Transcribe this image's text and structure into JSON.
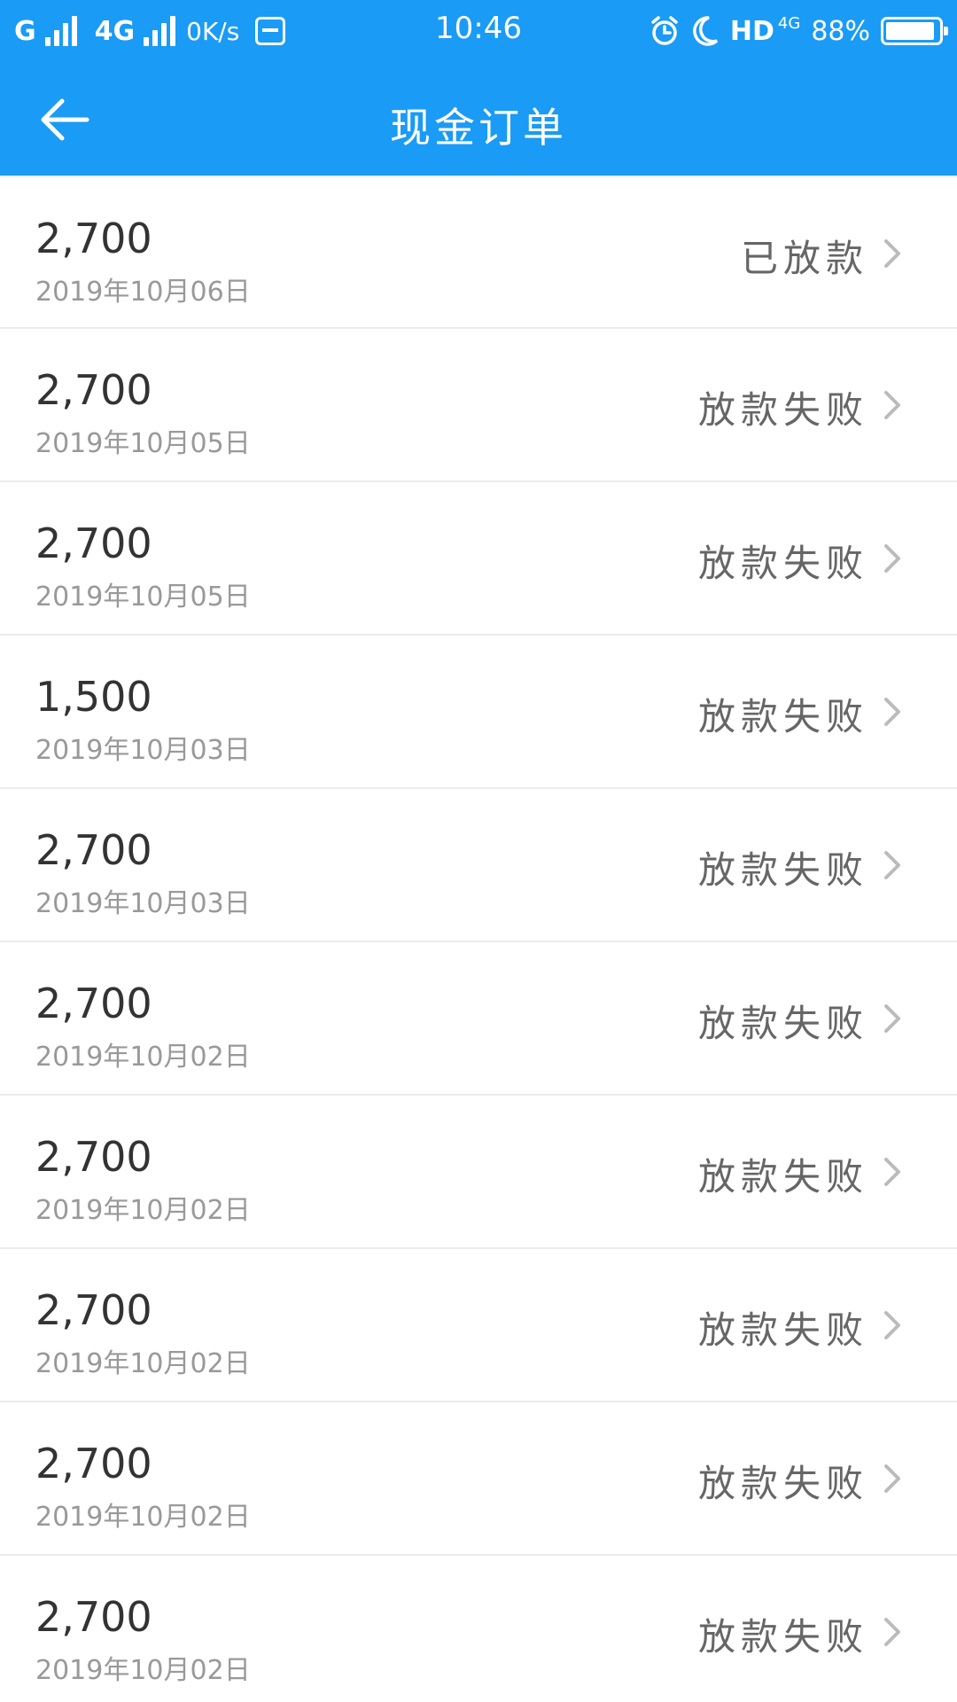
{
  "status_bar": {
    "carrier_1": "G",
    "carrier_2": "4G",
    "speed": "0K/s",
    "time": "10:46",
    "hd": "HD",
    "network_sup": "4G",
    "battery": "88%",
    "icons": [
      "signal-icon",
      "pay-icon",
      "alarm-icon",
      "moon-icon",
      "battery-icon"
    ]
  },
  "nav": {
    "title": "现金订单",
    "back_icon": "arrow-left-icon"
  },
  "orders": [
    {
      "amount": "2,700",
      "date": "2019年10月06日",
      "status": "已放款"
    },
    {
      "amount": "2,700",
      "date": "2019年10月05日",
      "status": "放款失败"
    },
    {
      "amount": "2,700",
      "date": "2019年10月05日",
      "status": "放款失败"
    },
    {
      "amount": "1,500",
      "date": "2019年10月03日",
      "status": "放款失败"
    },
    {
      "amount": "2,700",
      "date": "2019年10月03日",
      "status": "放款失败"
    },
    {
      "amount": "2,700",
      "date": "2019年10月02日",
      "status": "放款失败"
    },
    {
      "amount": "2,700",
      "date": "2019年10月02日",
      "status": "放款失败"
    },
    {
      "amount": "2,700",
      "date": "2019年10月02日",
      "status": "放款失败"
    },
    {
      "amount": "2,700",
      "date": "2019年10月02日",
      "status": "放款失败"
    },
    {
      "amount": "2,700",
      "date": "2019年10月02日",
      "status": "放款失败"
    }
  ],
  "colors": {
    "header": "#1a9bf5",
    "amount": "#333333",
    "date": "#999999",
    "status": "#666666",
    "divider": "#ececec"
  }
}
